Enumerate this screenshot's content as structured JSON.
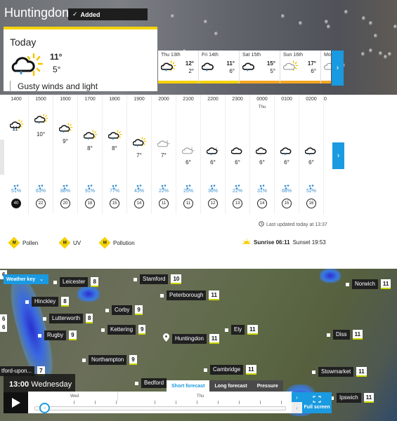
{
  "header": {
    "location": "Huntingdon",
    "added_label": "Added"
  },
  "today": {
    "label": "Today",
    "high": "11°",
    "low": "5°",
    "summary": "Gusty winds and light",
    "icon": "sun-cloud-rain-icon"
  },
  "days": [
    {
      "name": "Thu 13th",
      "high": "12°",
      "low": "2°",
      "icon": "sun-cloud-rain-icon",
      "bar_color": "#f5d20a"
    },
    {
      "name": "Fri 14th",
      "high": "11°",
      "low": "6°",
      "icon": "cloud-rain-icon",
      "bar_color": "#f5d20a"
    },
    {
      "name": "Sat 15th",
      "high": "15°",
      "low": "5°",
      "icon": "cloud-rain-icon",
      "bar_color": "#f5a623"
    },
    {
      "name": "Sun 16th",
      "high": "17°",
      "low": "6°",
      "icon": "sun-cloud-icon",
      "bar_color": "#f5a623"
    },
    {
      "name": "Mo",
      "high": "",
      "low": "",
      "icon": "cloud-icon",
      "bar_color": "#f5a623"
    }
  ],
  "hourly": [
    {
      "time": "1400",
      "day": "",
      "temp": "11°",
      "icon": "sun-cloud-rain",
      "rain": "51%",
      "wind": "40",
      "gust": true
    },
    {
      "time": "1500",
      "day": "",
      "temp": "10°",
      "icon": "sun-cloud-rain",
      "rain": "63%",
      "wind": "22",
      "gust": false
    },
    {
      "time": "1600",
      "day": "",
      "temp": "9°",
      "icon": "sun-cloud-rain",
      "rain": "88%",
      "wind": "20",
      "gust": false
    },
    {
      "time": "1700",
      "day": "",
      "temp": "8°",
      "icon": "sun-cloud-rain",
      "rain": "91%",
      "wind": "18",
      "gust": false
    },
    {
      "time": "1800",
      "day": "",
      "temp": "8°",
      "icon": "sun-cloud-rain",
      "rain": "77%",
      "wind": "15",
      "gust": false
    },
    {
      "time": "1900",
      "day": "",
      "temp": "7°",
      "icon": "sun-cloud-rain",
      "rain": "43%",
      "wind": "14",
      "gust": false
    },
    {
      "time": "2000",
      "day": "",
      "temp": "7°",
      "icon": "moon-cloud",
      "rain": "22%",
      "wind": "11",
      "gust": false
    },
    {
      "time": "2100",
      "day": "",
      "temp": "6°",
      "icon": "moon-cloud",
      "rain": "25%",
      "wind": "11",
      "gust": false
    },
    {
      "time": "2200",
      "day": "",
      "temp": "6°",
      "icon": "moon-cloud-rain",
      "rain": "36%",
      "wind": "12",
      "gust": false
    },
    {
      "time": "2300",
      "day": "",
      "temp": "6°",
      "icon": "cloud",
      "rain": "22%",
      "wind": "13",
      "gust": false
    },
    {
      "time": "0000",
      "day": "Thu",
      "temp": "6°",
      "icon": "cloud-drizzle",
      "rain": "31%",
      "wind": "14",
      "gust": false
    },
    {
      "time": "0100",
      "day": "",
      "temp": "6°",
      "icon": "cloud-rain",
      "rain": "68%",
      "wind": "15",
      "gust": false
    },
    {
      "time": "0200",
      "day": "",
      "temp": "6°",
      "icon": "cloud-rain",
      "rain": "52%",
      "wind": "16",
      "gust": false
    }
  ],
  "last_updated": "Last updated today at 13:37",
  "environment": [
    {
      "level": "M",
      "label": "Pollen"
    },
    {
      "level": "M",
      "label": "UV"
    },
    {
      "level": "M",
      "label": "Pollution"
    }
  ],
  "sun": {
    "sunrise_label": "Sunrise 06:11",
    "sunset_label": "Sunset 19:53"
  },
  "map": {
    "weather_key_label": "Weather key",
    "time_label_time": "13:00",
    "time_label_day": "Wednesday",
    "timeline_days": [
      "Wed",
      "Thu"
    ],
    "tabs": [
      "Short forecast",
      "Long forecast",
      "Pressure"
    ],
    "active_tab": "Short forecast",
    "fullscreen_label": "Full screen",
    "cities": [
      {
        "name": "Leicester",
        "temp": "8"
      },
      {
        "name": "Stamford",
        "temp": "10"
      },
      {
        "name": "Peterborough",
        "temp": "11"
      },
      {
        "name": "Norwich",
        "temp": "11"
      },
      {
        "name": "Hinckley",
        "temp": "8"
      },
      {
        "name": "Corby",
        "temp": "9"
      },
      {
        "name": "Lutterworth",
        "temp": "8"
      },
      {
        "name": "Kettering",
        "temp": "9"
      },
      {
        "name": "Ely",
        "temp": "11"
      },
      {
        "name": "Rugby",
        "temp": "9"
      },
      {
        "name": "Huntingdon",
        "temp": "11"
      },
      {
        "name": "Diss",
        "temp": "11"
      },
      {
        "name": "Northampton",
        "temp": "9"
      },
      {
        "name": "tford-upon...",
        "temp": "7"
      },
      {
        "name": "Cambridge",
        "temp": "11"
      },
      {
        "name": "Stowmarket",
        "temp": "11"
      },
      {
        "name": "Bedford",
        "temp": ""
      },
      {
        "name": "Ipswich",
        "temp": "11"
      }
    ],
    "edge_temps": [
      "6",
      "6",
      "6"
    ]
  }
}
